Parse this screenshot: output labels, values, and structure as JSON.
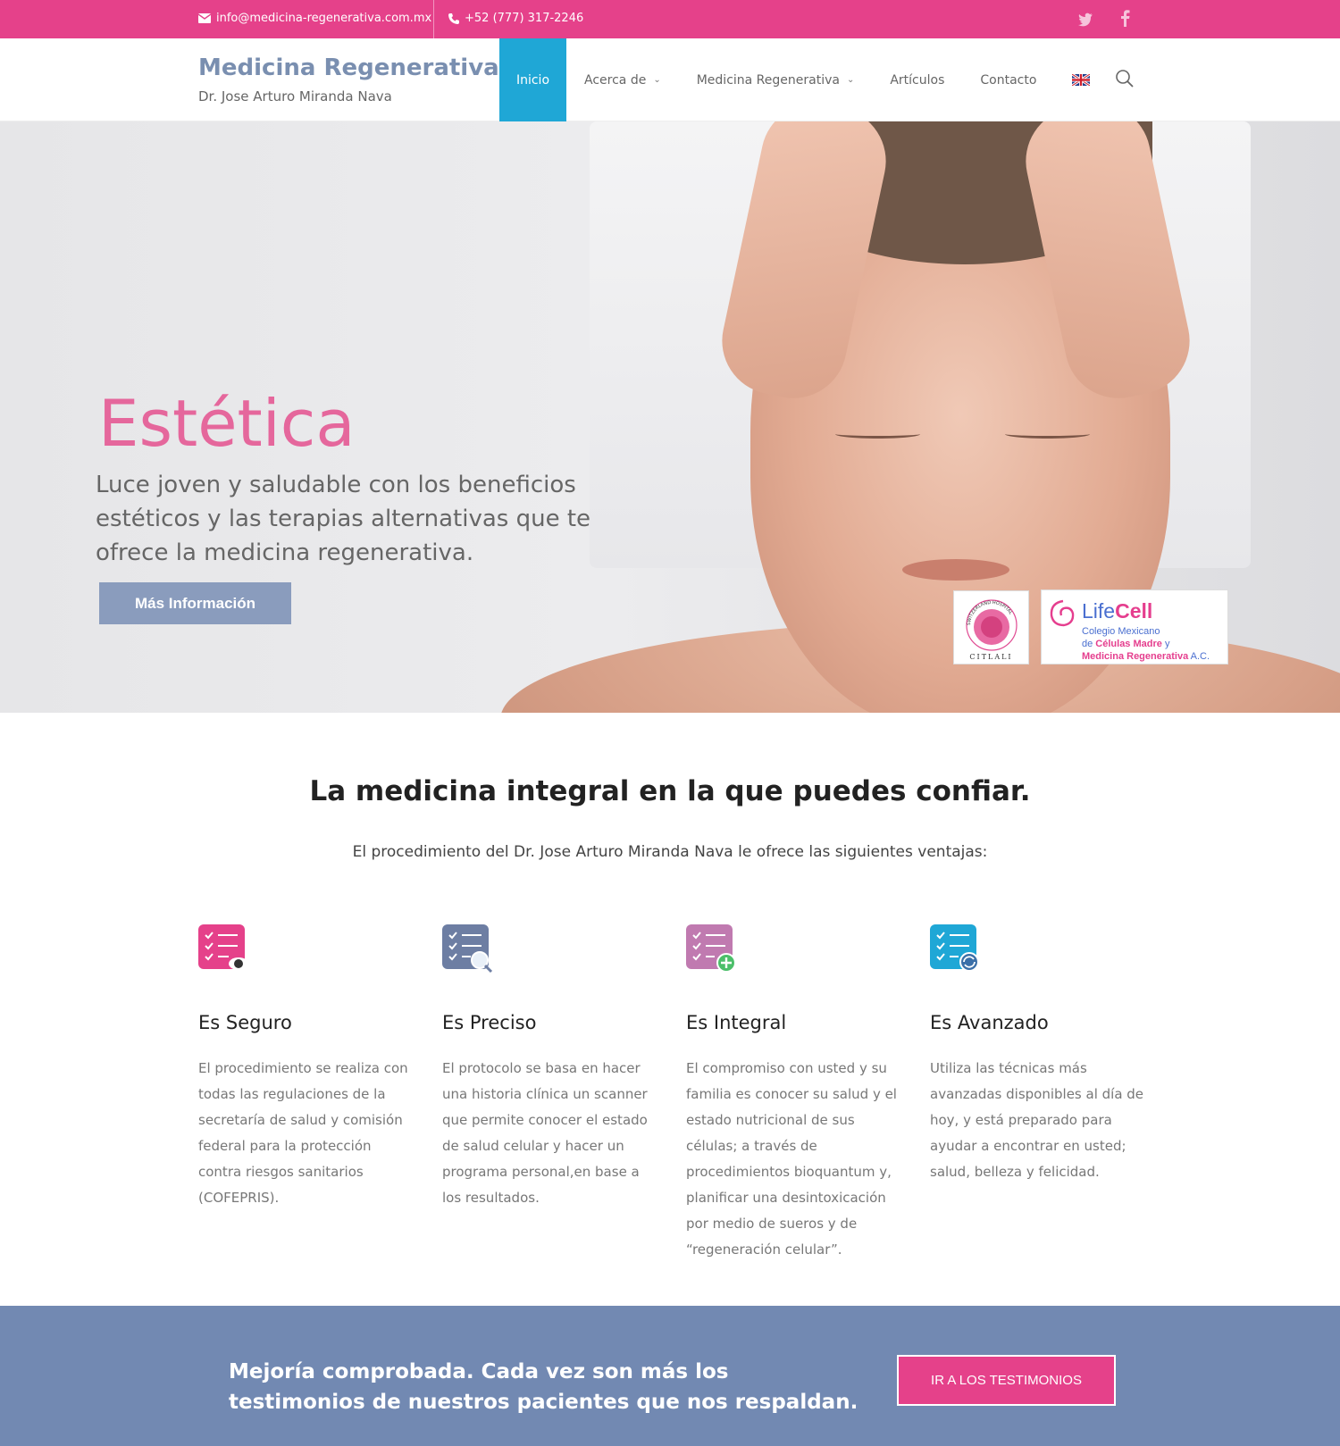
{
  "topbar": {
    "email": "info@medicina-regenerativa.com.mx",
    "phone": "+52 (777) 317-2246",
    "social": [
      "twitter-icon",
      "facebook-icon"
    ]
  },
  "header": {
    "title": "Medicina Regenerativa",
    "subtitle": "Dr. Jose Arturo Miranda Nava",
    "nav": [
      {
        "label": "Inicio",
        "active": true
      },
      {
        "label": "Acerca de",
        "dropdown": true
      },
      {
        "label": "Medicina Regenerativa",
        "dropdown": true
      },
      {
        "label": "Artículos"
      },
      {
        "label": "Contacto"
      }
    ],
    "language_flag": "uk-flag-icon"
  },
  "hero": {
    "title": "Estética",
    "text": "Luce joven y saludable con los beneficios estéticos y las terapias alternativas que te ofrece la medicina regenerativa.",
    "button": "Más Información",
    "logo_citlali": "CITLALI",
    "logo_citlali_ring": "SWITZERLAND HOSPITAL",
    "logo_lifecell_brand_life": "Life",
    "logo_lifecell_brand_cell": "Cell",
    "logo_lifecell_line1": "Colegio Mexicano",
    "logo_lifecell_line2a": "de ",
    "logo_lifecell_line2b": "Células Madre",
    "logo_lifecell_line2c": " y",
    "logo_lifecell_line3a": "Medicina Regenerativa",
    "logo_lifecell_line3b": " A.C."
  },
  "intro": {
    "title": "La medicina integral en la que puedes confiar.",
    "subtitle": "El procedimiento del Dr. Jose Arturo Miranda Nava le ofrece las siguientes ventajas:"
  },
  "features": [
    {
      "title": "Es Seguro",
      "text": "El procedimiento se realiza con todas las regulaciones de la secretaría de salud y comisión federal para la protección contra riesgos sanitarios (COFEPRIS).",
      "color": "#e5418a",
      "icon": "checklist-eye-icon"
    },
    {
      "title": "Es Preciso",
      "text": "El protocolo se basa en hacer una historia clínica  un scanner que permite conocer el estado de salud celular y hacer un programa personal,en base a los resultados.",
      "color": "#6d7ea3",
      "icon": "checklist-magnifier-icon"
    },
    {
      "title": "Es Integral",
      "text": "El compromiso con usted y su familia es conocer su salud y el estado nutricional de sus células; a través de procedimientos bioquantum y, planificar una desintoxicación por medio de sueros y de “regeneración celular”.",
      "color": "#c07ab0",
      "icon": "checklist-plus-icon"
    },
    {
      "title": "Es Avanzado",
      "text": "Utiliza las técnicas más avanzadas disponibles al día de hoy, y está preparado para ayudar a encontrar en usted; salud, belleza y felicidad.",
      "color": "#1fa7d6",
      "icon": "checklist-refresh-icon"
    }
  ],
  "band": {
    "text": "Mejoría comprobada. Cada vez son más los testimonios de nuestros pacientes que nos respaldan.",
    "button": "IR A LOS TESTIMONIOS"
  },
  "colors": {
    "accent_pink": "#e5418a",
    "accent_blue": "#1fa7d6",
    "brand_slate": "#7289b2"
  }
}
